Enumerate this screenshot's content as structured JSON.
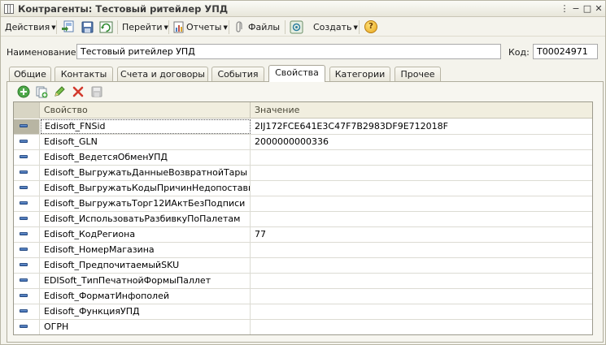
{
  "window": {
    "title": "Контрагенты: Тестовый ритейлер УПД",
    "controls": {
      "menu": "⋮",
      "minimize": "−",
      "maximize": "□",
      "close": "✕"
    }
  },
  "toolbar": {
    "actions_label": "Действия",
    "goto_label": "Перейти",
    "reports_label": "Отчеты",
    "files_label": "Файлы",
    "create_label": "Создать",
    "help_label": "?"
  },
  "form": {
    "name_label": "Наименование:",
    "name_value": "Тестовый ритейлер УПД",
    "code_label": "Код:",
    "code_value": "Т00024971"
  },
  "tabs": [
    {
      "label": "Общие"
    },
    {
      "label": "Контакты"
    },
    {
      "label": "Счета и договоры"
    },
    {
      "label": "События"
    },
    {
      "label": "Свойства",
      "active": true
    },
    {
      "label": "Категории"
    },
    {
      "label": "Прочее"
    }
  ],
  "table": {
    "columns": {
      "property": "Свойство",
      "value": "Значение"
    },
    "rows": [
      {
        "property": "Edisoft_FNSid",
        "value": "2IJ172FCE641E3C47F7B2983DF9E712018F"
      },
      {
        "property": "Edisoft_GLN",
        "value": "2000000000336"
      },
      {
        "property": "Edisoft_ВедетсяОбменУПД",
        "value": ""
      },
      {
        "property": "Edisoft_ВыгружатьДанныеВозвратнойТары",
        "value": ""
      },
      {
        "property": "Edisoft_ВыгружатьКодыПричинНедопоставки",
        "value": ""
      },
      {
        "property": "Edisoft_ВыгружатьТорг12ИАктБезПодписи",
        "value": ""
      },
      {
        "property": "Edisoft_ИспользоватьРазбивкуПоПалетам",
        "value": ""
      },
      {
        "property": "Edisoft_КодРегиона",
        "value": "77"
      },
      {
        "property": "Edisoft_НомерМагазина",
        "value": ""
      },
      {
        "property": "Edisoft_ПредпочитаемыйSKU",
        "value": ""
      },
      {
        "property": "EDISoft_ТипПечатнойФормыПаллет",
        "value": ""
      },
      {
        "property": "Edisoft_ФорматИнфополей",
        "value": ""
      },
      {
        "property": "Edisoft_ФункцияУПД",
        "value": ""
      },
      {
        "property": "ОГРН",
        "value": ""
      }
    ]
  }
}
